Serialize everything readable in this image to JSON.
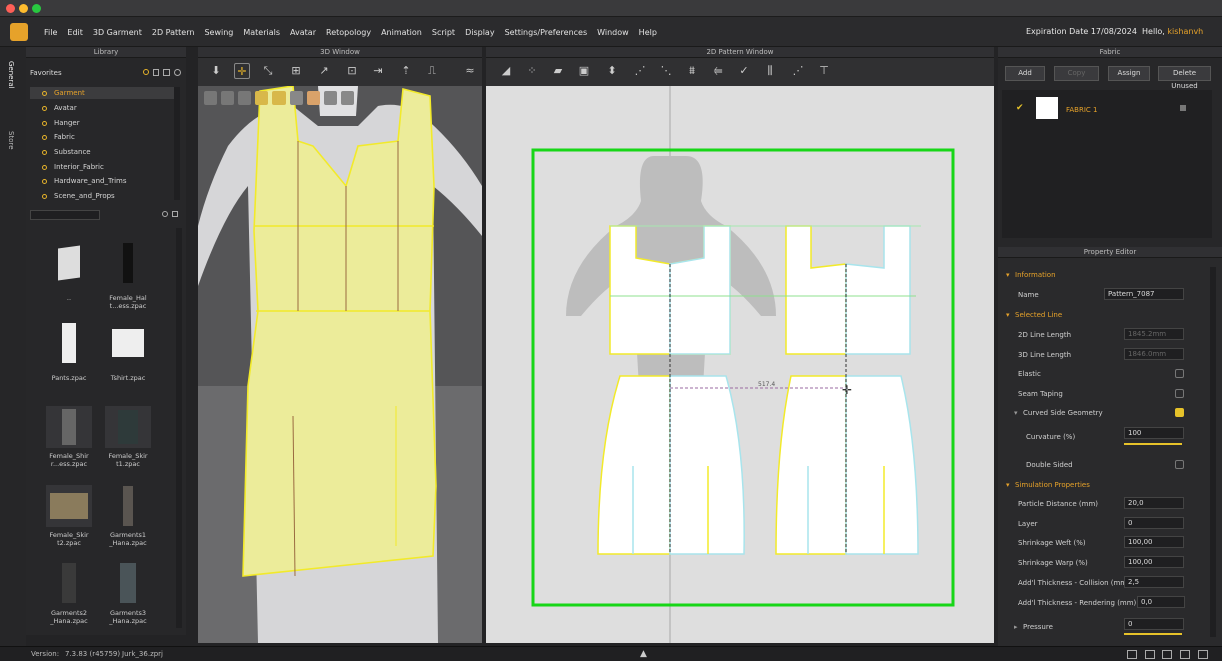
{
  "menu": [
    "File",
    "Edit",
    "3D Garment",
    "2D Pattern",
    "Sewing",
    "Materials",
    "Avatar",
    "Retopology",
    "Animation",
    "Script",
    "Display",
    "Settings/Preferences",
    "Window",
    "Help"
  ],
  "account": {
    "expiry": "Expiration Date 17/08/2024",
    "hello": "Hello,",
    "user": "kishanvh"
  },
  "side_tabs": [
    "General",
    "Store"
  ],
  "library": {
    "title": "Library",
    "favorites_label": "Favorites",
    "favorites": [
      "Garment",
      "Avatar",
      "Hanger",
      "Fabric",
      "Substance",
      "Interior_Fabric",
      "Hardware_and_Trims",
      "Scene_and_Props"
    ],
    "files": [
      {
        "name": ".."
      },
      {
        "name": "Female_Hal t...ess.zpac"
      },
      {
        "name": "Pants.zpac"
      },
      {
        "name": "Tshirt.zpac"
      },
      {
        "name": "Female_Shir r...ess.zpac"
      },
      {
        "name": "Female_Skir t1.zpac"
      },
      {
        "name": "Female_Skir t2.zpac"
      },
      {
        "name": "Garments1 _Hana.zpac"
      },
      {
        "name": "Garments2 _Hana.zpac"
      },
      {
        "name": "Garments3 _Hana.zpac"
      }
    ]
  },
  "window3d": {
    "title": "3D Window"
  },
  "window2d": {
    "title": "2D Pattern Window",
    "measure_label": "517.4"
  },
  "fabric": {
    "title": "Fabric",
    "add": "Add",
    "copy": "Copy",
    "assign": "Assign",
    "delete_unused": "Delete Unused",
    "item": "FABRIC 1"
  },
  "property_editor": {
    "title": "Property Editor",
    "information": "Information",
    "name_label": "Name",
    "name_value": "Pattern_7087",
    "selected_line": "Selected Line",
    "line2d_label": "2D Line Length",
    "line2d_value": "1845.2mm",
    "line3d_label": "3D Line Length",
    "line3d_value": "1846.0mm",
    "elastic": "Elastic",
    "seam_taping": "Seam Taping",
    "curved": "Curved Side Geometry",
    "curvature_label": "Curvature (%)",
    "curvature_value": "100",
    "double_sided": "Double Sided",
    "simulation": "Simulation Properties",
    "particle_label": "Particle Distance (mm)",
    "particle_value": "20,0",
    "layer_label": "Layer",
    "layer_value": "0",
    "weft_label": "Shrinkage Weft (%)",
    "weft_value": "100,00",
    "warp_label": "Shrinkage Warp (%)",
    "warp_value": "100,00",
    "collision_label": "Add'l Thickness - Collision (mm)",
    "collision_value": "2,5",
    "rendering_label": "Add'l Thickness - Rendering (mm)",
    "rendering_value": "0,0",
    "pressure_label": "Pressure",
    "pressure_value": "0"
  },
  "status": {
    "version_label": "Version:",
    "version": "7.3.83 (r45759)",
    "file": "Jurk_36.zprj"
  },
  "colors": {
    "accent": "#e6a22a",
    "pattern_yellow": "#f2ea2a",
    "pattern_cyan": "#a8e4ec",
    "board_green": "#17d617"
  }
}
